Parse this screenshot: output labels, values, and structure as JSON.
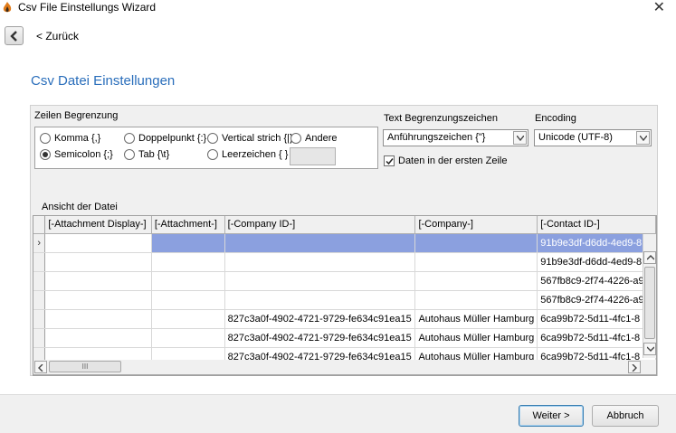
{
  "window": {
    "title": "Csv File Einstellungs Wizard",
    "close_glyph": "✕"
  },
  "nav": {
    "back_label": "< Zurück"
  },
  "page": {
    "title": "Csv Datei Einstellungen"
  },
  "delimiter": {
    "group_label": "Zeilen Begrenzung",
    "options": [
      {
        "label": "Komma {,}",
        "selected": false
      },
      {
        "label": "Doppelpunkt {:}",
        "selected": false
      },
      {
        "label": "Vertical strich {|}",
        "selected": false
      },
      {
        "label": "Andere",
        "selected": false
      },
      {
        "label": "Semicolon {;}",
        "selected": true
      },
      {
        "label": "Tab {\\t}",
        "selected": false
      },
      {
        "label": "Leerzeichen { }",
        "selected": false
      }
    ],
    "other_value": ""
  },
  "text_qualifier": {
    "label": "Text Begrenzungszeichen",
    "value": "Anführungszeichen {\"}"
  },
  "encoding": {
    "label": "Encoding",
    "value": "Unicode (UTF-8)"
  },
  "header_row": {
    "label": "Daten in der ersten Zeile",
    "checked": true
  },
  "preview": {
    "label": "Ansicht der Datei",
    "columns": [
      "[-Attachment Display-]",
      "[-Attachment-]",
      "[-Company ID-]",
      "[-Company-]",
      "[-Contact ID-]"
    ],
    "rows": [
      [
        "",
        "",
        "",
        "",
        "91b9e3df-d6dd-4ed9-8"
      ],
      [
        "",
        "",
        "",
        "",
        "91b9e3df-d6dd-4ed9-8"
      ],
      [
        "",
        "",
        "",
        "",
        "567fb8c9-2f74-4226-a9"
      ],
      [
        "",
        "",
        "",
        "",
        "567fb8c9-2f74-4226-a9"
      ],
      [
        "",
        "",
        "827c3a0f-4902-4721-9729-fe634c91ea15",
        "Autohaus Müller Hamburg",
        "6ca99b72-5d11-4fc1-8"
      ],
      [
        "",
        "",
        "827c3a0f-4902-4721-9729-fe634c91ea15",
        "Autohaus Müller Hamburg",
        "6ca99b72-5d11-4fc1-8"
      ],
      [
        "",
        "",
        "827c3a0f-4902-4721-9729-fe634c91ea15",
        "Autohaus Müller Hamburg",
        "6ca99b72-5d11-4fc1-8"
      ]
    ],
    "row_indicator": "›",
    "hscroll_grip": "III"
  },
  "footer": {
    "next_label": "Weiter >",
    "cancel_label": "Abbruch"
  },
  "colors": {
    "accent": "#2a6ebb",
    "selection": "#8ba0df"
  }
}
